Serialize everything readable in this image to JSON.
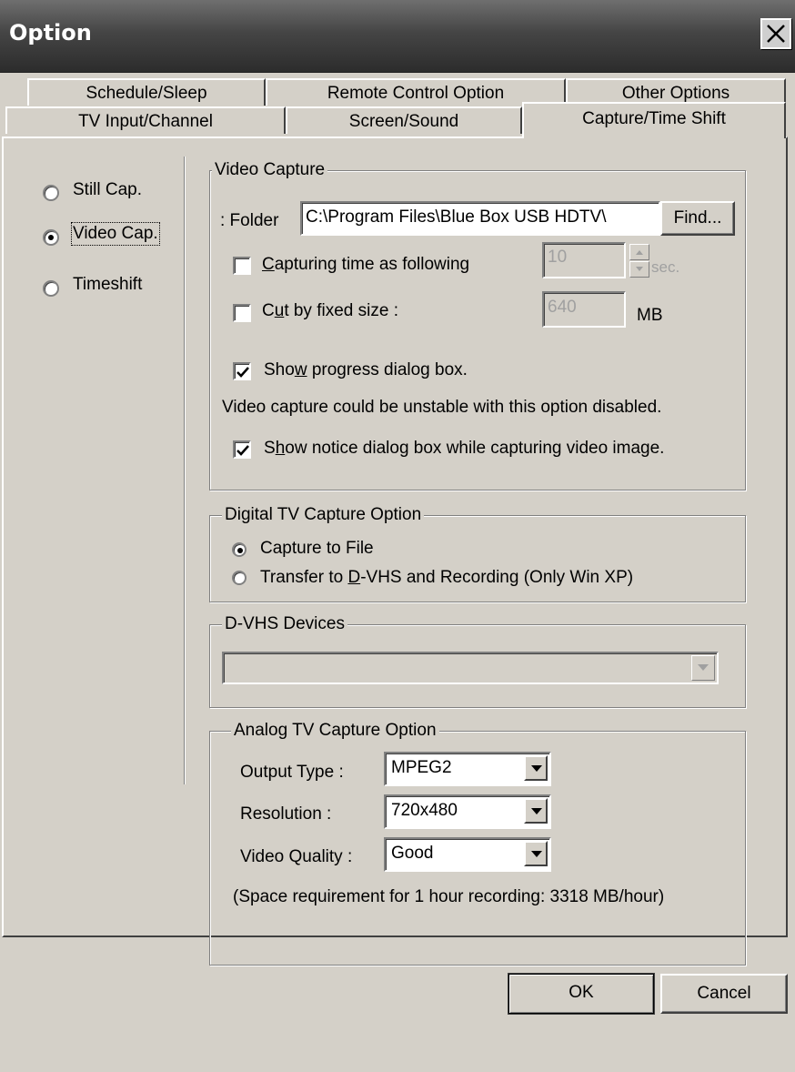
{
  "window": {
    "title": "Option",
    "close_label": "close"
  },
  "tabs": {
    "row1": [
      "Schedule/Sleep",
      "Remote Control Option",
      "Other Options"
    ],
    "row2": [
      "TV Input/Channel",
      "Screen/Sound",
      "Capture/Time Shift"
    ],
    "active": "Capture/Time Shift"
  },
  "nav": {
    "items": [
      {
        "label": "Still Cap.",
        "checked": false
      },
      {
        "label": "Video Cap.",
        "checked": true
      },
      {
        "label": "Timeshift",
        "checked": false
      }
    ]
  },
  "video_capture": {
    "title": "Video Capture",
    "folder_label": ": Folder",
    "folder_value": "C:\\Program Files\\Blue Box USB HDTV\\",
    "find_label": "Find...",
    "capture_time_label_pre": "",
    "capture_time_label_u": "C",
    "capture_time_label_post": "apturing time as following",
    "capture_time_checked": false,
    "capture_time_value": "10",
    "capture_time_unit": "sec.",
    "cut_label_pre": "C",
    "cut_label_u": "u",
    "cut_label_post": "t by fixed size :",
    "cut_checked": false,
    "cut_value": "640",
    "cut_unit": "MB",
    "progress_label_pre": "Sho",
    "progress_label_u": "w",
    "progress_label_post": " progress dialog box.",
    "progress_checked": true,
    "warning_text": "Video capture could be unstable with this option disabled.",
    "notice_label_pre": "S",
    "notice_label_u": "h",
    "notice_label_post": "ow notice dialog box while capturing video image.",
    "notice_checked": true
  },
  "digital_tv": {
    "title": "Digital TV Capture Option",
    "option1": "Capture to File",
    "option2_pre": "Transfer to ",
    "option2_u": "D",
    "option2_post": "-VHS and Recording (Only Win XP)",
    "selected": "Capture to File"
  },
  "dvhs": {
    "title": "D-VHS Devices",
    "value": ""
  },
  "analog_tv": {
    "title": "Analog TV Capture Option",
    "output_type_label": "Output Type :",
    "output_type_value": "MPEG2",
    "resolution_label": "Resolution :",
    "resolution_value": "720x480",
    "quality_label": "Video Quality :",
    "quality_value": "Good",
    "space_note": "(Space requirement for 1 hour recording: 3318 MB/hour)"
  },
  "footer": {
    "ok_label": "OK",
    "cancel_label": "Cancel"
  }
}
